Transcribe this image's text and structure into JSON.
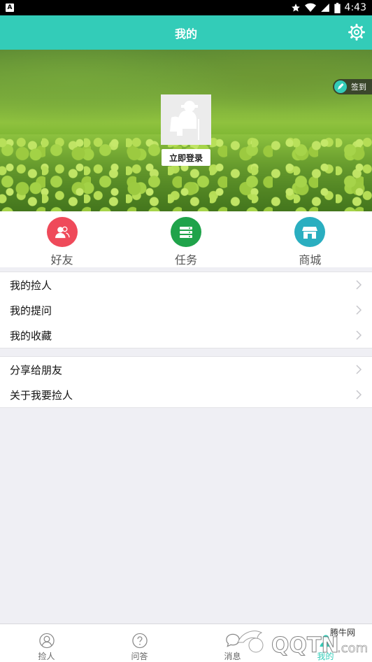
{
  "status_bar": {
    "notification_icon": "A",
    "time": "4:43",
    "icons": [
      "star-icon",
      "wifi-icon",
      "signal-icon",
      "battery-icon"
    ]
  },
  "header": {
    "title": "我的",
    "settings_icon": "gear-icon"
  },
  "banner": {
    "signin_label": "签到",
    "login_label": "立即登录"
  },
  "quick_actions": [
    {
      "label": "好友",
      "icon": "friends-icon",
      "color": "#ef4a5a"
    },
    {
      "label": "任务",
      "icon": "task-icon",
      "color": "#1fa34a"
    },
    {
      "label": "商城",
      "icon": "store-icon",
      "color": "#2aaec0"
    }
  ],
  "menu_group_1": [
    {
      "label": "我的捡人"
    },
    {
      "label": "我的提问"
    },
    {
      "label": "我的收藏"
    }
  ],
  "menu_group_2": [
    {
      "label": "分享给朋友"
    },
    {
      "label": "关于我要捡人"
    }
  ],
  "bottom_nav": [
    {
      "label": "捡人",
      "icon": "person-icon"
    },
    {
      "label": "问答",
      "icon": "question-icon"
    },
    {
      "label": "消息",
      "icon": "message-icon"
    },
    {
      "label": "我的",
      "icon": "profile-icon"
    }
  ],
  "watermark": {
    "text_top": "腾牛网",
    "text_main": "QQTN",
    "text_suffix": ".com"
  },
  "colors": {
    "accent": "#33ccb8",
    "background": "#efeff4"
  }
}
